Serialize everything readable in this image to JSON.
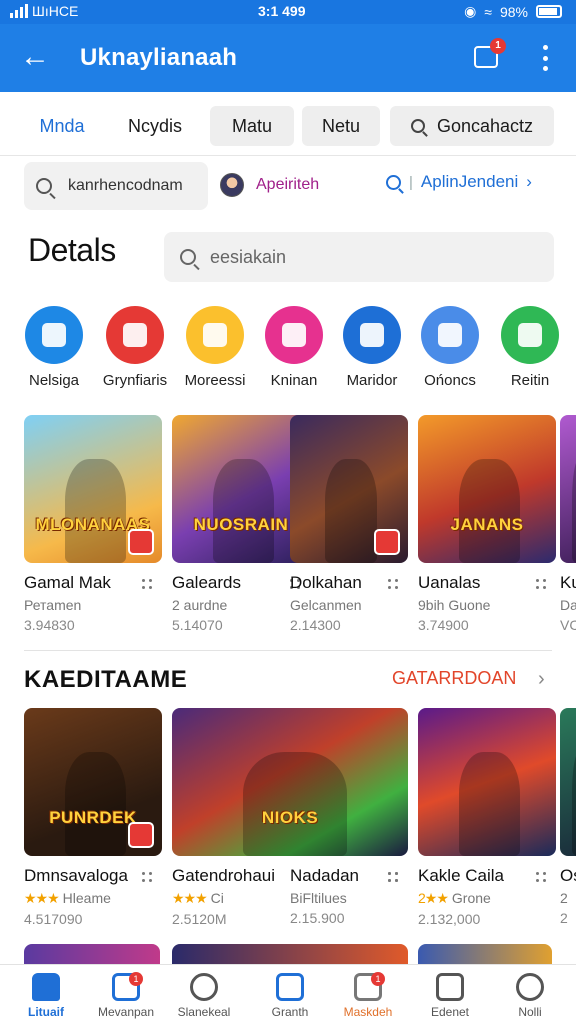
{
  "status_bar": {
    "left_text": "ШıHCE",
    "time": "3:1 499",
    "battery": "98%"
  },
  "app_bar": {
    "title": "Uknaylianaah",
    "notif_count": "1"
  },
  "tabs": [
    {
      "label": "Mnda",
      "active": true,
      "chip": false,
      "search_icon": false
    },
    {
      "label": "Ncydis",
      "active": false,
      "chip": false,
      "search_icon": false
    },
    {
      "label": "Matu",
      "active": false,
      "chip": true,
      "search_icon": false
    },
    {
      "label": "Netu",
      "active": false,
      "chip": true,
      "search_icon": false
    },
    {
      "label": "Goncahactz",
      "active": false,
      "chip": true,
      "search_icon": true
    }
  ],
  "filter_row": {
    "search_text": "kanrhencodnam",
    "user_label": "Apeiriteh",
    "link_label": "AplinJendeni"
  },
  "details": {
    "title": "Detals",
    "search_placeholder": "eesiakain"
  },
  "categories": [
    {
      "label": "Nelsiga",
      "color": "#1e88e5",
      "icon": "camera-icon"
    },
    {
      "label": "Grynfiaris",
      "color": "#e53935",
      "icon": "note-icon"
    },
    {
      "label": "Moreessi",
      "color": "#fbc02d",
      "icon": "gallery-icon"
    },
    {
      "label": "Kninan",
      "color": "#e6318f",
      "icon": "music-disc-icon"
    },
    {
      "label": "Maridor",
      "color": "#1e6fd6",
      "icon": "tools-icon"
    },
    {
      "label": "Ońoncs",
      "color": "#4a8ce8",
      "icon": "chart-icon"
    },
    {
      "label": "Reitin",
      "color": "#2fb855",
      "icon": "chat-icon"
    }
  ],
  "featured_cards": [
    {
      "name": "Gamal Mak",
      "sub": "Ретаmen",
      "meta": "3.94830",
      "art_title": "MLONANAAS",
      "bg": "linear-gradient(160deg,#7fd0f5,#f6b94a 70%,#e58a2a)",
      "wide": false
    },
    {
      "name": "Galeards",
      "sub": "2 aurdne",
      "meta": "5.14070",
      "art_title": "NUOSRAIN",
      "bg": "linear-gradient(150deg,#f0a830,#7a3fb0 55%,#2b1f5a)",
      "wide": false
    },
    {
      "name": "Dolkahan",
      "sub": "Gelcanmen",
      "meta": "2.14300",
      "art_title": "",
      "bg": "linear-gradient(150deg,#3a2a5e,#8b4a2a 55%,#2a1b2f)",
      "wide": false
    },
    {
      "name": "Uanalas",
      "sub": "9bih Guone",
      "meta": "3.74900",
      "art_title": "JANANS",
      "bg": "linear-gradient(160deg,#f39a2a,#c0392b 55%,#2c2a6e)",
      "wide": false
    },
    {
      "name": "Ku",
      "sub": "Da",
      "meta": "VC",
      "art_title": "",
      "bg": "linear-gradient(160deg,#b05ad0,#40205a)",
      "wide": false
    }
  ],
  "section2": {
    "title": "KAEDITAAME",
    "link": "GATARRDOAN"
  },
  "grid_cards": [
    {
      "name": "Dmnsavaloga",
      "sub": "Hleame",
      "stars": "★★★",
      "meta": "4.517090",
      "art_title": "PUNRDEK",
      "bg": "linear-gradient(160deg,#6a3a1a,#2a1a10 70%)",
      "wide": false
    },
    {
      "name": "Gatendrohaui",
      "sub": "Ci",
      "stars": "★★★",
      "meta": "2.5120M",
      "art_title": "NIOKS",
      "bg": "linear-gradient(150deg,#4a2a7a,#c0402a 45%,#40b040 75%,#1a1a40)",
      "wide": true
    },
    {
      "name": "Nadadan",
      "sub": "BiFltilues",
      "stars": "",
      "meta": "2.15.900",
      "art_title": "",
      "bg": "",
      "wide": false
    },
    {
      "name": "Kakle Caila",
      "sub": "Grone",
      "stars": "2★★",
      "meta": "2.132,000",
      "art_title": "",
      "bg": "linear-gradient(160deg,#5a1a8a,#e04a2a 50%,#1a2a5a)",
      "wide": false
    },
    {
      "name": "Os",
      "sub": "2",
      "stars": "",
      "meta": "2",
      "art_title": "",
      "bg": "linear-gradient(160deg,#2a7a5a,#1a2a3a)",
      "wide": false
    }
  ],
  "bottom_nav": [
    {
      "label": "Lituaif",
      "icon": "home-icon",
      "active": true,
      "badge": "",
      "color": "#1f6fd6"
    },
    {
      "label": "Mevanpan",
      "icon": "user-group-icon",
      "active": false,
      "badge": "1",
      "color": "#1f6fd6"
    },
    {
      "label": "Slanekeal",
      "icon": "heart-icon",
      "active": false,
      "badge": "",
      "color": "#555555"
    },
    {
      "label": "Granth",
      "icon": "edit-icon",
      "active": false,
      "badge": "",
      "color": "#1f6fd6"
    },
    {
      "label": "Maskdeh",
      "icon": "gamepad-icon",
      "active": false,
      "badge": "1",
      "color": "#777777"
    },
    {
      "label": "Edenet",
      "icon": "list-icon",
      "active": false,
      "badge": "",
      "color": "#555555"
    },
    {
      "label": "Nolli",
      "icon": "profile-icon",
      "active": false,
      "badge": "",
      "color": "#555555"
    }
  ]
}
